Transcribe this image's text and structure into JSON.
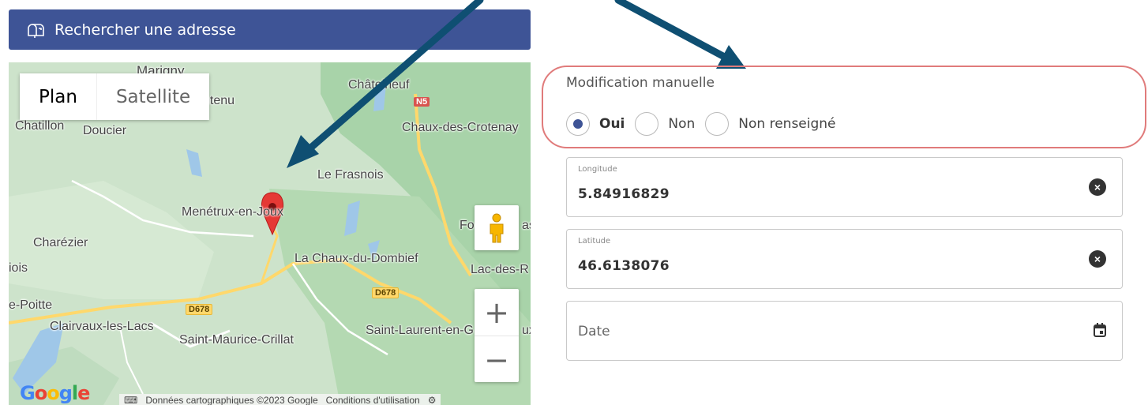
{
  "search": {
    "label": "Rechercher une adresse",
    "icon": "mailbox-icon",
    "color": "#3e5496"
  },
  "map": {
    "type_control": {
      "plan": "Plan",
      "satellite": "Satellite"
    },
    "places": [
      {
        "name": "Marigny"
      },
      {
        "name": "ntenu"
      },
      {
        "name": "Châtelneuf"
      },
      {
        "name": "Chatillon"
      },
      {
        "name": "Doucier"
      },
      {
        "name": "Chaux-des-Crotenay"
      },
      {
        "name": "Le Frasnois"
      },
      {
        "name": "Menétrux-en-Joux"
      },
      {
        "name": "Fo"
      },
      {
        "name": "as"
      },
      {
        "name": "Charézier"
      },
      {
        "name": "La Chaux-du-Dombief"
      },
      {
        "name": "iois"
      },
      {
        "name": "Lac-des-R"
      },
      {
        "name": "e-Poitte"
      },
      {
        "name": "Clairvaux-les-Lacs"
      },
      {
        "name": "Saint-Laurent-en-G"
      },
      {
        "name": "ux"
      },
      {
        "name": "Saint-Maurice-Crillat"
      }
    ],
    "routes": {
      "n5": "N5",
      "d678a": "D678",
      "d678b": "D678"
    },
    "zoom_in": "+",
    "zoom_out": "−",
    "logo": {
      "g1": "G",
      "o1": "o",
      "o2": "o",
      "g2": "g",
      "l": "l",
      "e": "e"
    },
    "attribution": {
      "data": "Données cartographiques ©2023 Google",
      "terms": "Conditions d'utilisation"
    }
  },
  "form": {
    "modification": {
      "title": "Modification manuelle",
      "options": [
        {
          "label": "Oui",
          "checked": true
        },
        {
          "label": "Non",
          "checked": false
        },
        {
          "label": "Non renseigné",
          "checked": false
        }
      ]
    },
    "longitude": {
      "label": "Longitude",
      "value": "5.84916829"
    },
    "latitude": {
      "label": "Latitude",
      "value": "46.6138076"
    },
    "date": {
      "label": "Date"
    }
  },
  "colors": {
    "accent": "#3e5496",
    "highlight_border": "#e07b7b",
    "arrow": "#0f4f72",
    "marker": "#e53935"
  }
}
